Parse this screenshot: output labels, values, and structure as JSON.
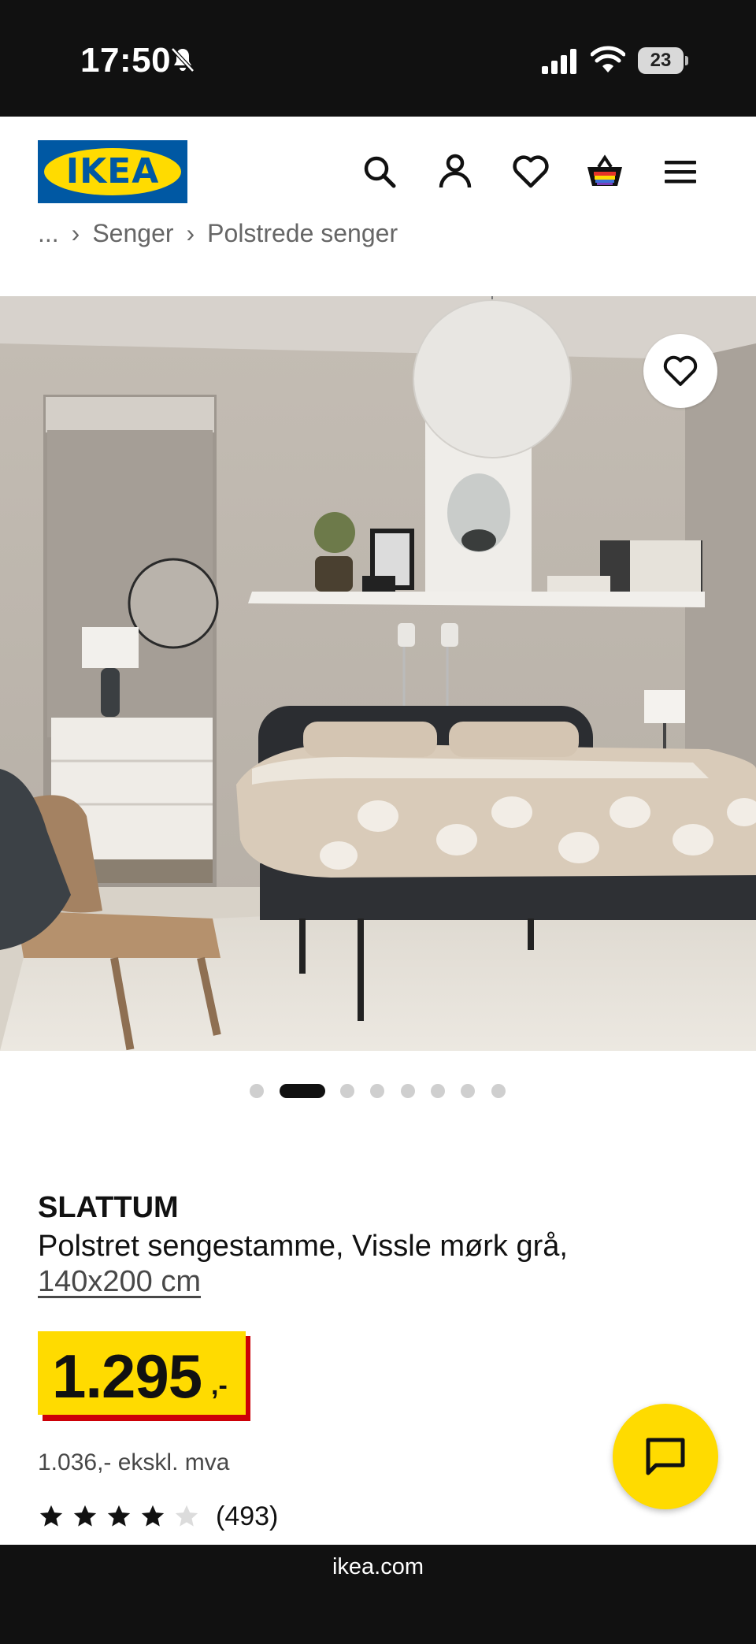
{
  "status_bar": {
    "time": "17:50",
    "battery": "23",
    "icons": [
      "bell-slash-icon",
      "cellular-signal-icon",
      "wifi-icon",
      "battery-icon"
    ]
  },
  "header": {
    "logo_text": "IKEA",
    "icons": [
      "search-icon",
      "account-icon",
      "heart-icon",
      "basket-icon",
      "menu-icon"
    ]
  },
  "breadcrumb": [
    "...",
    "Senger",
    "Polstrede senger"
  ],
  "gallery": {
    "total_images": 8,
    "active_index": 1
  },
  "product": {
    "name": "SLATTUM",
    "description": "Polstret sengestamme, Vissle mørk grå,",
    "size": "140x200 cm",
    "price_int": "1.295",
    "price_dec": ",-",
    "price_ex_vat": "1.036,- ekskl. mva",
    "rating": 4,
    "rating_max": 5,
    "reviews": "(493)"
  },
  "browser": {
    "url": "ikea.com"
  },
  "colors": {
    "ikea_blue": "#0058a3",
    "ikea_yellow": "#ffdb00",
    "price_red": "#cc0008"
  }
}
